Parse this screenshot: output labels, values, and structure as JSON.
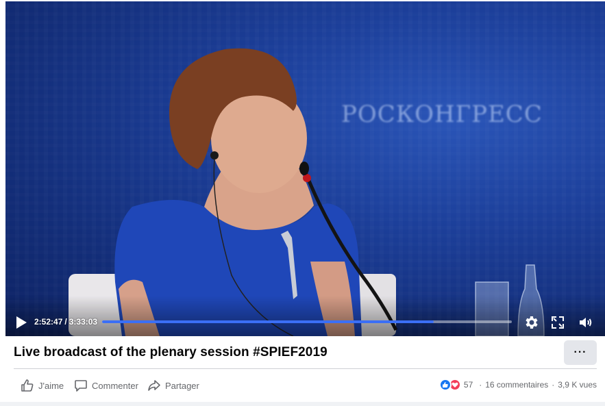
{
  "video": {
    "background_brand_text": "РОСКОНГРЕСС",
    "current_time": "2:52:47",
    "duration": "3:33:03",
    "time_separator": "/",
    "progress_fraction": 0.81,
    "buffered_fraction": 0.81,
    "icons": [
      "play-icon",
      "settings-gear-icon",
      "fullscreen-icon",
      "volume-icon"
    ]
  },
  "post": {
    "title": "Live broadcast of the plenary session #SPIEF2019",
    "more_label": "···"
  },
  "actions": {
    "like_label": "J'aime",
    "comment_label": "Commenter",
    "share_label": "Partager"
  },
  "stats": {
    "reaction_count": "57",
    "comments": "16 commentaires",
    "separator": "·",
    "views": "3,9 K vues"
  },
  "colors": {
    "accent": "#3b6ff5",
    "like_blue": "#1877f2",
    "love_red": "#f33e58",
    "text_primary": "#050505",
    "text_secondary": "#65676b"
  }
}
